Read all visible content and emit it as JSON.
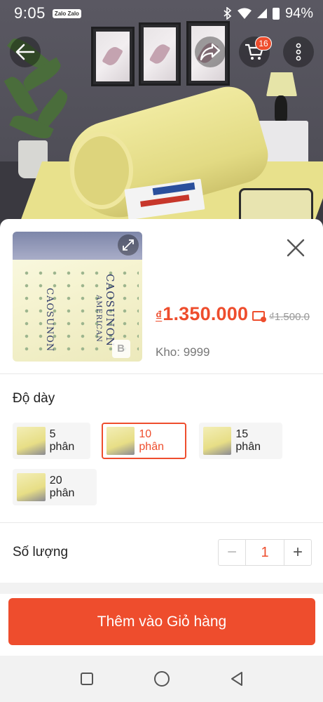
{
  "status_bar": {
    "time": "9:05",
    "notification_label": "Zalo Zalo",
    "battery": "94%"
  },
  "header": {
    "cart_count": "16"
  },
  "product": {
    "image_brand_text": "CAOSUNON",
    "image_brand_sub": "AMERICAN",
    "currency_symbol": "₫",
    "price": "1.350.000",
    "old_price": "₫1.500.0",
    "stock": "Kho: 9999",
    "watermark": "B"
  },
  "variants": {
    "label": "Độ dày",
    "options": [
      {
        "label": "5 phân",
        "selected": false
      },
      {
        "label": "10 phân",
        "selected": true
      },
      {
        "label": "15 phân",
        "selected": false
      },
      {
        "label": "20 phân",
        "selected": false
      }
    ]
  },
  "quantity": {
    "label": "Số lượng",
    "value": "1",
    "minus": "−",
    "plus": "+"
  },
  "actions": {
    "add_to_cart": "Thêm vào Giỏ hàng"
  },
  "colors": {
    "accent": "#ee4d2d",
    "price": "#ee4d2d"
  },
  "icons": {
    "back": "arrow-left-icon",
    "share": "share-icon",
    "cart": "cart-icon",
    "more": "more-vertical-icon",
    "expand": "expand-icon",
    "close": "close-icon",
    "voucher": "voucher-icon",
    "nav_recent": "square-icon",
    "nav_home": "circle-icon",
    "nav_back": "triangle-back-icon"
  }
}
